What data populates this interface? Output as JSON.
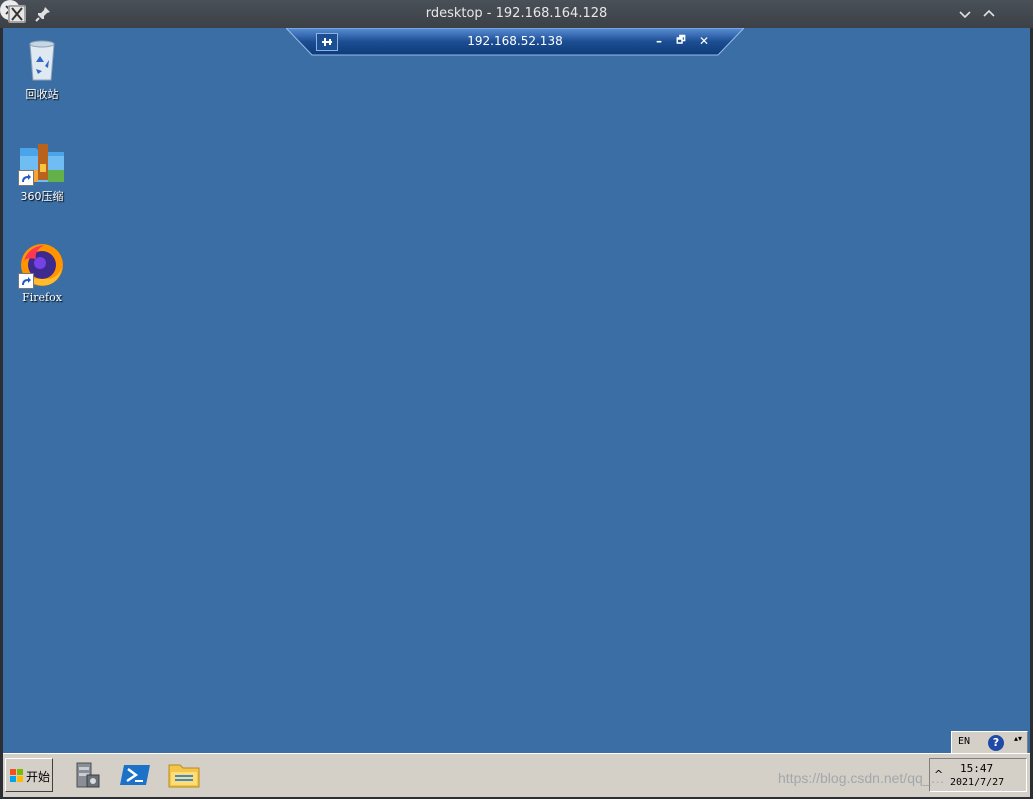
{
  "window": {
    "title": "rdesktop - 192.168.164.128"
  },
  "connection_bar": {
    "title": "192.168.52.138",
    "min_glyph": "–",
    "restore_glyph": "🗗",
    "close_glyph": "✕"
  },
  "desktop_icons": [
    {
      "label": "回收站",
      "icon": "recycle-bin-icon"
    },
    {
      "label": "360压缩",
      "icon": "archive-icon"
    },
    {
      "label": "Firefox",
      "icon": "firefox-icon"
    }
  ],
  "language_bar": {
    "lang": "EN",
    "help": "?",
    "options": "▴▾"
  },
  "taskbar": {
    "start_label": "开始",
    "apps": [
      {
        "name": "server-manager",
        "icon": "server-manager-icon"
      },
      {
        "name": "powershell",
        "icon": "powershell-icon"
      },
      {
        "name": "explorer",
        "icon": "folder-icon"
      }
    ],
    "tray_arrow": "^",
    "clock_time": "15:47",
    "clock_date": "2021/7/27"
  },
  "watermark": "https://blog.csdn.net/qq_…",
  "colors": {
    "desktop": "#3a6ea5",
    "taskbar": "#d4d0c8",
    "title_bar": "#3c4147"
  }
}
